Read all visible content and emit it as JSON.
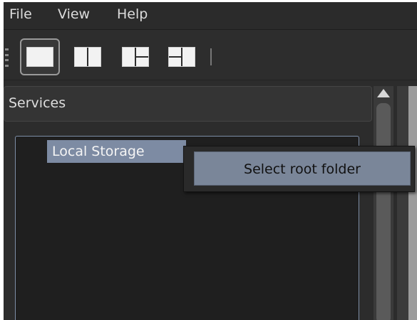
{
  "menubar": {
    "items": [
      {
        "label": "File"
      },
      {
        "label": "View"
      },
      {
        "label": "Help"
      }
    ]
  },
  "toolbar": {
    "buttons": [
      {
        "icon": "single-pane-layout-icon",
        "active": true
      },
      {
        "icon": "two-column-layout-icon",
        "active": false
      },
      {
        "icon": "three-pane-right-split-layout-icon",
        "active": false
      },
      {
        "icon": "three-pane-left-split-layout-icon",
        "active": false
      }
    ]
  },
  "services_panel": {
    "title": "Services",
    "tree_items": [
      {
        "label": "Local Storage",
        "selected": true
      }
    ]
  },
  "context_menu": {
    "items": [
      {
        "label": "Select root folder"
      }
    ]
  },
  "colors": {
    "selection": "#7d8ba3",
    "background": "#2c2c2c",
    "tree_background": "#1f1f1f"
  }
}
